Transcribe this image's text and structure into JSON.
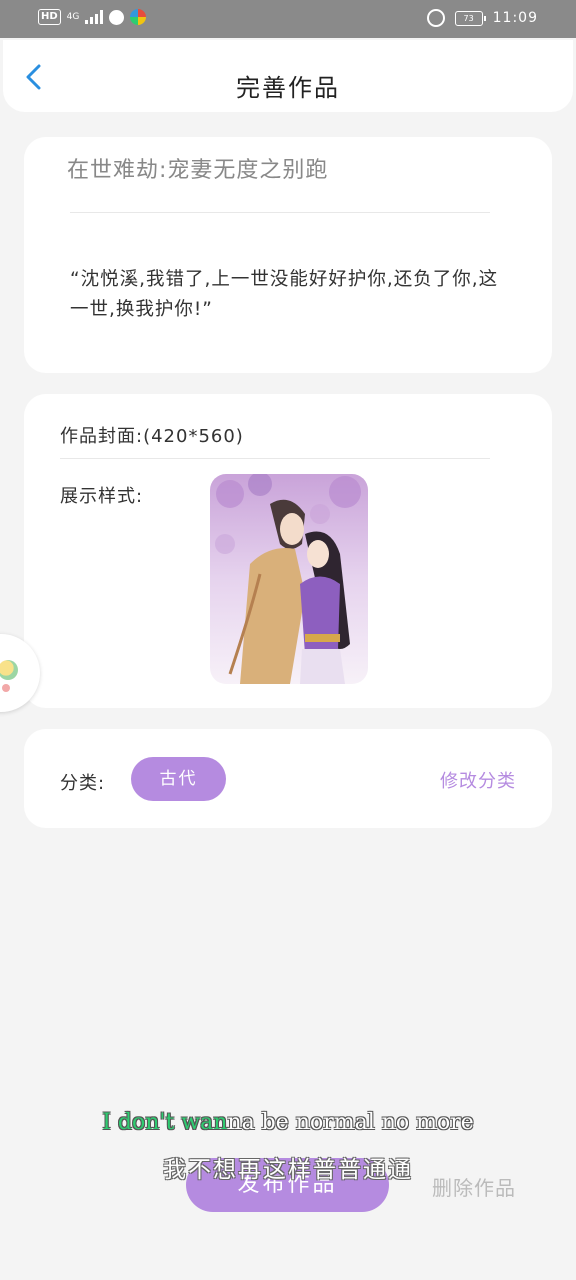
{
  "status_bar": {
    "hd": "HD",
    "network": "4G",
    "battery": "73",
    "time": "11:09"
  },
  "nav": {
    "title": "完善作品"
  },
  "work": {
    "title": "在世难劫:宠妻无度之别跑",
    "quote": "“沈悦溪,我错了,上一世没能好好护你,还负了你,这一世,换我护你!”"
  },
  "cover": {
    "label": "作品封面:(420*560)",
    "display_label": "展示样式:"
  },
  "category": {
    "label": "分类:",
    "tag": "古代",
    "modify": "修改分类"
  },
  "actions": {
    "publish": "发布作品",
    "delete": "删除作品"
  },
  "subtitles": {
    "en_highlight": "I don't wan",
    "en_rest": "na be normal no more",
    "zh": "我不想再这样普普通通"
  },
  "colors": {
    "accent": "#b58be0",
    "back_arrow": "#2a8fe0"
  }
}
